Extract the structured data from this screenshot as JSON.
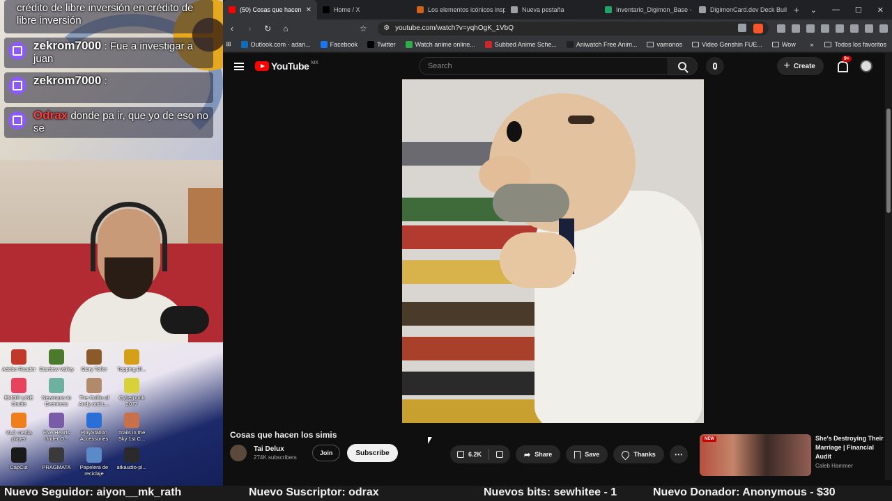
{
  "chat": {
    "first_text": "crédito de libre inversión en crédito de libre inversión",
    "messages": [
      {
        "user": "zekrom7000",
        "text": ": Fue a investigar a juan"
      },
      {
        "user": "zekrom7000",
        "text": ":"
      },
      {
        "user": "Odrax",
        "text": " donde pa ir, que yo de eso no se"
      }
    ]
  },
  "desktop_icons": [
    {
      "label": "Adobe Reader",
      "color": "#c0392b"
    },
    {
      "label": "Stardew Valley",
      "color": "#4a7a2a"
    },
    {
      "label": "Story Teller",
      "color": "#8a5a2a"
    },
    {
      "label": "Topping Bl...",
      "color": "#d4a017"
    },
    {
      "label": "EMOR LINE Studio",
      "color": "#e8435e"
    },
    {
      "label": "Newmans to Evenness",
      "color": "#6fb1a0"
    },
    {
      "label": "The Coffin of Andy and L...",
      "color": "#b08a6a"
    },
    {
      "label": "Cyberpunk 2077",
      "color": "#d8d23a"
    },
    {
      "label": "VLC media player",
      "color": "#ef7f1a"
    },
    {
      "label": "Five Hearts Under O...",
      "color": "#7a5ba8"
    },
    {
      "label": "PlayStation Accessories",
      "color": "#2a6fd8"
    },
    {
      "label": "Trails in the Sky 1st C...",
      "color": "#c8704a"
    },
    {
      "label": "CapCut",
      "color": "#1a1a1a"
    },
    {
      "label": "PRAGMATA",
      "color": "#3a3a3a"
    },
    {
      "label": "Papelera de reciclaje",
      "color": "#5a8ac8"
    },
    {
      "label": "atkaudio-pl...",
      "color": "#2a2a2a"
    }
  ],
  "browser": {
    "tabs": [
      {
        "label": "(50) Cosas que hacen",
        "color": "#ff0000",
        "active": true
      },
      {
        "label": "Home / X",
        "color": "#000000",
        "active": false
      },
      {
        "label": "Los elementos icónicos insp",
        "color": "#d4631a",
        "active": false
      },
      {
        "label": "Nueva pestaña",
        "color": "#9aa0a6",
        "active": false
      },
      {
        "label": "Inventario_Digimon_Base -",
        "color": "#1fa463",
        "active": false
      },
      {
        "label": "DigimonCard.dev Deck Buil",
        "color": "#9aa0a6",
        "active": false
      }
    ],
    "url": "youtube.com/watch?v=yqhOgK_1VbQ",
    "bookmarks": [
      {
        "label": "Outlook.com - adan...",
        "color": "#0f6cbd",
        "folder": false
      },
      {
        "label": "Facebook",
        "color": "#1877f2",
        "folder": false
      },
      {
        "label": "Twitter",
        "color": "#000000",
        "folder": false
      },
      {
        "label": "Watch anime online...",
        "color": "#2fae4a",
        "folder": false
      },
      {
        "label": "Subbed Anime Sche...",
        "color": "#d0232a",
        "folder": false
      },
      {
        "label": "Aniwatch Free Anim...",
        "color": "#222222",
        "folder": false
      },
      {
        "label": "vamonos",
        "color": "",
        "folder": true
      },
      {
        "label": "Video Genshin FUE...",
        "color": "",
        "folder": true
      },
      {
        "label": "Wow",
        "color": "",
        "folder": true
      }
    ],
    "bookmarks_all": "Todos los favoritos"
  },
  "youtube": {
    "logo_text": "YouTube",
    "region": "MX",
    "search_placeholder": "Search",
    "create_label": "Create",
    "notif_badge": "9+",
    "video_title": "Cosas que hacen los simis",
    "channel_name": "Tai Delux",
    "channel_subs": "274K subscribers",
    "join_label": "Join",
    "subscribe_label": "Subscribe",
    "likes": "6.2K",
    "share_label": "Share",
    "save_label": "Save",
    "thanks_label": "Thanks",
    "rec": {
      "badge": "NEW",
      "title": "She's Destroying Their Marriage | Financial Audit",
      "channel": "Caleb Hammer"
    }
  },
  "ticker": {
    "follower": "Nuevo Seguidor: aiyon__mk_rath",
    "subscriber": "Nuevo Suscriptor: odrax",
    "bits": "Nuevos bits: sewhitee - 1",
    "donor": "Nuevo Donador: Anonymous - $30"
  }
}
